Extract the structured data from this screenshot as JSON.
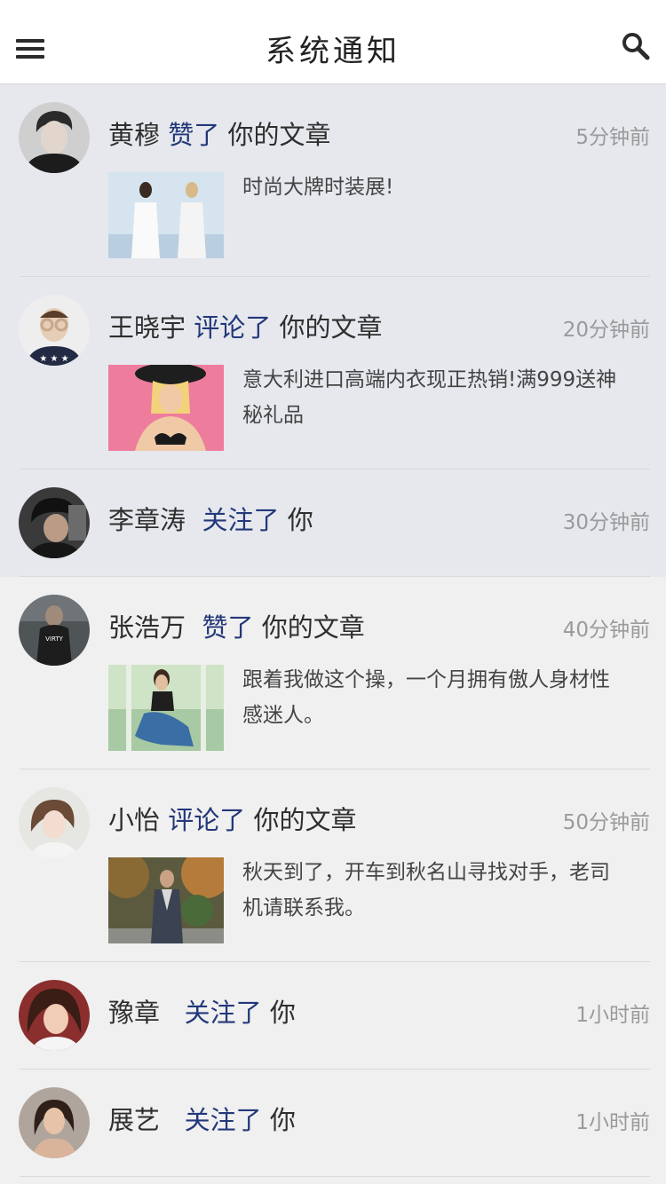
{
  "header": {
    "title": "系统通知",
    "menu_icon": "hamburger-menu-icon",
    "search_icon": "search-icon"
  },
  "notifications": [
    {
      "user": "黄穆",
      "action": "赞了",
      "object": "你的文章",
      "time": "5分钟前",
      "excerpt": "时尚大牌时装展!",
      "read": false
    },
    {
      "user": "王晓宇",
      "action": "评论了",
      "object": "你的文章",
      "time": "20分钟前",
      "excerpt": "意大利进口高端内衣现正热销!满999送神秘礼品",
      "read": false
    },
    {
      "user": "李章涛",
      "action": "关注了",
      "object": "你",
      "time": "30分钟前",
      "read": false
    },
    {
      "user": "张浩万",
      "action": "赞了",
      "object": "你的文章",
      "time": "40分钟前",
      "excerpt": "跟着我做这个操，一个月拥有傲人身材性感迷人。",
      "read": true
    },
    {
      "user": "小怡",
      "action": "评论了",
      "object": "你的文章",
      "time": "50分钟前",
      "excerpt": "秋天到了，开车到秋名山寻找对手，老司机请联系我。",
      "read": true
    },
    {
      "user": "豫章",
      "action": "关注了",
      "object": "你",
      "time": "1小时前",
      "read": true
    },
    {
      "user": "展艺",
      "action": "关注了",
      "object": "你",
      "time": "1小时前",
      "read": true
    }
  ],
  "colors": {
    "action": "#23387a",
    "unread_bg": "#e6e8ed",
    "read_bg": "#f0f0f0",
    "time": "#9a9a9a"
  }
}
